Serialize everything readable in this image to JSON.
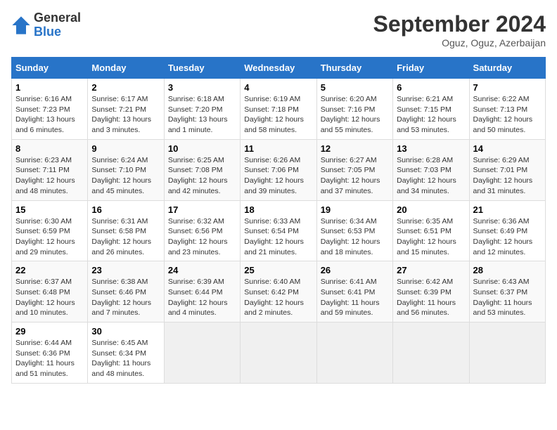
{
  "logo": {
    "general": "General",
    "blue": "Blue"
  },
  "header": {
    "month": "September 2024",
    "location": "Oguz, Oguz, Azerbaijan"
  },
  "days_of_week": [
    "Sunday",
    "Monday",
    "Tuesday",
    "Wednesday",
    "Thursday",
    "Friday",
    "Saturday"
  ],
  "weeks": [
    [
      {
        "day": "1",
        "sunrise": "Sunrise: 6:16 AM",
        "sunset": "Sunset: 7:23 PM",
        "daylight": "Daylight: 13 hours and 6 minutes."
      },
      {
        "day": "2",
        "sunrise": "Sunrise: 6:17 AM",
        "sunset": "Sunset: 7:21 PM",
        "daylight": "Daylight: 13 hours and 3 minutes."
      },
      {
        "day": "3",
        "sunrise": "Sunrise: 6:18 AM",
        "sunset": "Sunset: 7:20 PM",
        "daylight": "Daylight: 13 hours and 1 minute."
      },
      {
        "day": "4",
        "sunrise": "Sunrise: 6:19 AM",
        "sunset": "Sunset: 7:18 PM",
        "daylight": "Daylight: 12 hours and 58 minutes."
      },
      {
        "day": "5",
        "sunrise": "Sunrise: 6:20 AM",
        "sunset": "Sunset: 7:16 PM",
        "daylight": "Daylight: 12 hours and 55 minutes."
      },
      {
        "day": "6",
        "sunrise": "Sunrise: 6:21 AM",
        "sunset": "Sunset: 7:15 PM",
        "daylight": "Daylight: 12 hours and 53 minutes."
      },
      {
        "day": "7",
        "sunrise": "Sunrise: 6:22 AM",
        "sunset": "Sunset: 7:13 PM",
        "daylight": "Daylight: 12 hours and 50 minutes."
      }
    ],
    [
      {
        "day": "8",
        "sunrise": "Sunrise: 6:23 AM",
        "sunset": "Sunset: 7:11 PM",
        "daylight": "Daylight: 12 hours and 48 minutes."
      },
      {
        "day": "9",
        "sunrise": "Sunrise: 6:24 AM",
        "sunset": "Sunset: 7:10 PM",
        "daylight": "Daylight: 12 hours and 45 minutes."
      },
      {
        "day": "10",
        "sunrise": "Sunrise: 6:25 AM",
        "sunset": "Sunset: 7:08 PM",
        "daylight": "Daylight: 12 hours and 42 minutes."
      },
      {
        "day": "11",
        "sunrise": "Sunrise: 6:26 AM",
        "sunset": "Sunset: 7:06 PM",
        "daylight": "Daylight: 12 hours and 39 minutes."
      },
      {
        "day": "12",
        "sunrise": "Sunrise: 6:27 AM",
        "sunset": "Sunset: 7:05 PM",
        "daylight": "Daylight: 12 hours and 37 minutes."
      },
      {
        "day": "13",
        "sunrise": "Sunrise: 6:28 AM",
        "sunset": "Sunset: 7:03 PM",
        "daylight": "Daylight: 12 hours and 34 minutes."
      },
      {
        "day": "14",
        "sunrise": "Sunrise: 6:29 AM",
        "sunset": "Sunset: 7:01 PM",
        "daylight": "Daylight: 12 hours and 31 minutes."
      }
    ],
    [
      {
        "day": "15",
        "sunrise": "Sunrise: 6:30 AM",
        "sunset": "Sunset: 6:59 PM",
        "daylight": "Daylight: 12 hours and 29 minutes."
      },
      {
        "day": "16",
        "sunrise": "Sunrise: 6:31 AM",
        "sunset": "Sunset: 6:58 PM",
        "daylight": "Daylight: 12 hours and 26 minutes."
      },
      {
        "day": "17",
        "sunrise": "Sunrise: 6:32 AM",
        "sunset": "Sunset: 6:56 PM",
        "daylight": "Daylight: 12 hours and 23 minutes."
      },
      {
        "day": "18",
        "sunrise": "Sunrise: 6:33 AM",
        "sunset": "Sunset: 6:54 PM",
        "daylight": "Daylight: 12 hours and 21 minutes."
      },
      {
        "day": "19",
        "sunrise": "Sunrise: 6:34 AM",
        "sunset": "Sunset: 6:53 PM",
        "daylight": "Daylight: 12 hours and 18 minutes."
      },
      {
        "day": "20",
        "sunrise": "Sunrise: 6:35 AM",
        "sunset": "Sunset: 6:51 PM",
        "daylight": "Daylight: 12 hours and 15 minutes."
      },
      {
        "day": "21",
        "sunrise": "Sunrise: 6:36 AM",
        "sunset": "Sunset: 6:49 PM",
        "daylight": "Daylight: 12 hours and 12 minutes."
      }
    ],
    [
      {
        "day": "22",
        "sunrise": "Sunrise: 6:37 AM",
        "sunset": "Sunset: 6:48 PM",
        "daylight": "Daylight: 12 hours and 10 minutes."
      },
      {
        "day": "23",
        "sunrise": "Sunrise: 6:38 AM",
        "sunset": "Sunset: 6:46 PM",
        "daylight": "Daylight: 12 hours and 7 minutes."
      },
      {
        "day": "24",
        "sunrise": "Sunrise: 6:39 AM",
        "sunset": "Sunset: 6:44 PM",
        "daylight": "Daylight: 12 hours and 4 minutes."
      },
      {
        "day": "25",
        "sunrise": "Sunrise: 6:40 AM",
        "sunset": "Sunset: 6:42 PM",
        "daylight": "Daylight: 12 hours and 2 minutes."
      },
      {
        "day": "26",
        "sunrise": "Sunrise: 6:41 AM",
        "sunset": "Sunset: 6:41 PM",
        "daylight": "Daylight: 11 hours and 59 minutes."
      },
      {
        "day": "27",
        "sunrise": "Sunrise: 6:42 AM",
        "sunset": "Sunset: 6:39 PM",
        "daylight": "Daylight: 11 hours and 56 minutes."
      },
      {
        "day": "28",
        "sunrise": "Sunrise: 6:43 AM",
        "sunset": "Sunset: 6:37 PM",
        "daylight": "Daylight: 11 hours and 53 minutes."
      }
    ],
    [
      {
        "day": "29",
        "sunrise": "Sunrise: 6:44 AM",
        "sunset": "Sunset: 6:36 PM",
        "daylight": "Daylight: 11 hours and 51 minutes."
      },
      {
        "day": "30",
        "sunrise": "Sunrise: 6:45 AM",
        "sunset": "Sunset: 6:34 PM",
        "daylight": "Daylight: 11 hours and 48 minutes."
      },
      null,
      null,
      null,
      null,
      null
    ]
  ]
}
